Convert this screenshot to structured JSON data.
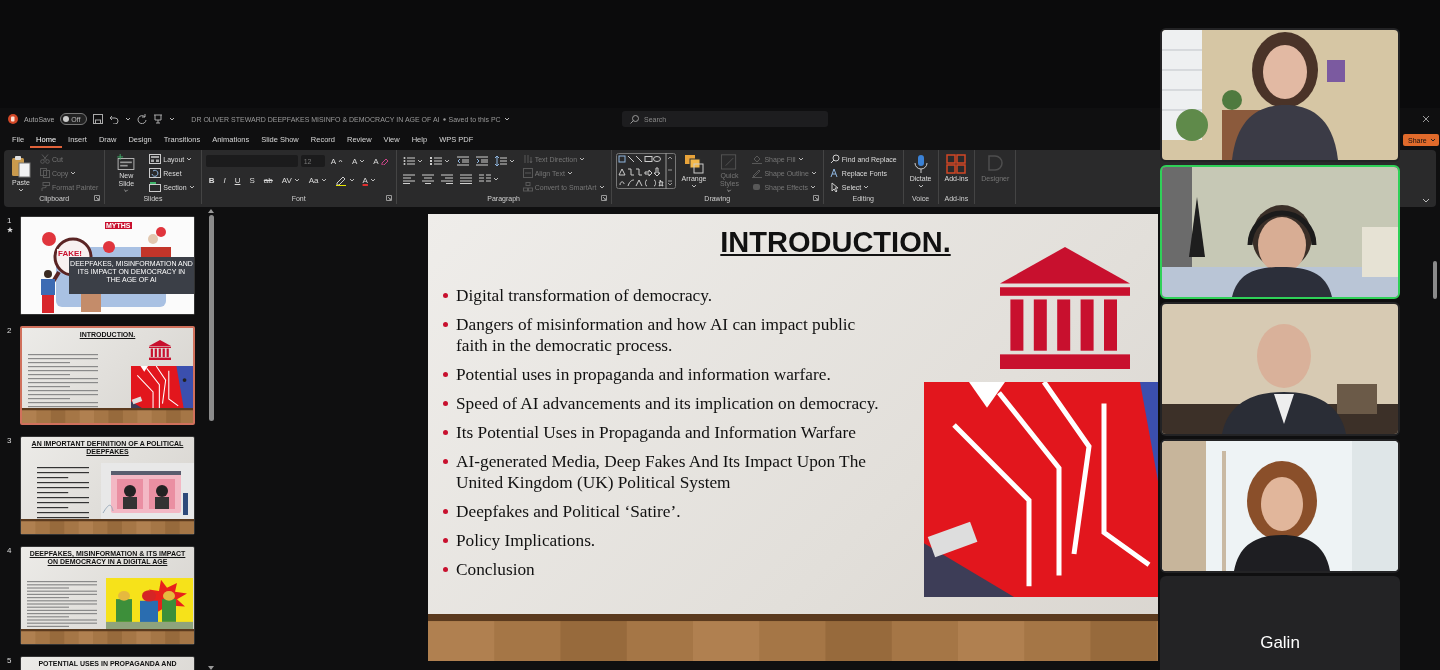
{
  "window": {
    "title": "DR OLIVER STEWARD DEEPFAKES MISINFO & DEMOCRACY IN AGE OF AI",
    "save_status": "Saved to this PC"
  },
  "autosave": {
    "label": "AutoSave",
    "state_label": "Off",
    "on": false
  },
  "search": {
    "placeholder": "Search"
  },
  "share_button": {
    "label": "Share"
  },
  "ribbon_tabs": [
    {
      "label": "File",
      "selected": false
    },
    {
      "label": "Home",
      "selected": true
    },
    {
      "label": "Insert",
      "selected": false
    },
    {
      "label": "Draw",
      "selected": false
    },
    {
      "label": "Design",
      "selected": false
    },
    {
      "label": "Transitions",
      "selected": false
    },
    {
      "label": "Animations",
      "selected": false
    },
    {
      "label": "Slide Show",
      "selected": false
    },
    {
      "label": "Record",
      "selected": false
    },
    {
      "label": "Review",
      "selected": false
    },
    {
      "label": "View",
      "selected": false
    },
    {
      "label": "Help",
      "selected": false
    },
    {
      "label": "WPS PDF",
      "selected": false
    }
  ],
  "ribbon_groups": [
    {
      "label": "Clipboard",
      "launcher": true,
      "columns": [
        [
          {
            "kind": "paste",
            "label": "Paste",
            "large": true,
            "dropdown": true,
            "disabled": false
          }
        ],
        [
          {
            "kind": "cut",
            "label": "Cut",
            "disabled": true
          },
          {
            "kind": "copy",
            "label": "Copy",
            "dropdown": true,
            "disabled": true
          },
          {
            "kind": "painter",
            "label": "Format Painter",
            "disabled": true
          }
        ]
      ]
    },
    {
      "label": "Slides",
      "columns": [
        [
          {
            "kind": "newslide",
            "label": "New Slide",
            "large": true,
            "dropdown": true
          }
        ],
        [
          {
            "kind": "layout",
            "label": "Layout",
            "dropdown": true
          },
          {
            "kind": "reset",
            "label": "Reset"
          },
          {
            "kind": "section",
            "label": "Section",
            "dropdown": true
          }
        ]
      ]
    },
    {
      "label": "Font",
      "launcher": true,
      "rows": [
        [
          {
            "kind": "fontname"
          },
          {
            "kind": "fontsize",
            "value": "12",
            "disabled": true
          },
          {
            "kind": "grow",
            "label": "A"
          },
          {
            "kind": "shrink",
            "label": "A"
          },
          {
            "kind": "clear",
            "label": "A"
          }
        ],
        [
          {
            "kind": "bold",
            "label": "B"
          },
          {
            "kind": "italic",
            "label": "I"
          },
          {
            "kind": "underline",
            "label": "U"
          },
          {
            "kind": "shadow",
            "label": "S"
          },
          {
            "kind": "strike",
            "label": "ab"
          },
          {
            "kind": "spacing",
            "label": "AV",
            "dropdown": true
          },
          {
            "kind": "case",
            "label": "Aa",
            "dropdown": true
          },
          {
            "kind": "highlight",
            "dropdown": true
          },
          {
            "kind": "color",
            "label": "A",
            "dropdown": true
          }
        ]
      ]
    },
    {
      "label": "Paragraph",
      "launcher": true,
      "rows": [
        [
          {
            "kind": "bullets",
            "dropdown": true
          },
          {
            "kind": "numbering",
            "dropdown": true
          },
          {
            "kind": "outdent"
          },
          {
            "kind": "indent"
          },
          {
            "kind": "linespacing",
            "dropdown": true
          }
        ],
        [
          {
            "kind": "alignleft"
          },
          {
            "kind": "aligncenter"
          },
          {
            "kind": "alignright"
          },
          {
            "kind": "justify"
          },
          {
            "kind": "columns",
            "dropdown": true
          }
        ]
      ],
      "columns": [
        [
          {
            "kind": "textdir",
            "label": "Text Direction",
            "dropdown": true,
            "disabled": true
          },
          {
            "kind": "aligntext",
            "label": "Align Text",
            "dropdown": true,
            "disabled": true
          },
          {
            "kind": "smartart",
            "label": "Convert to SmartArt",
            "dropdown": true,
            "disabled": true
          }
        ]
      ]
    },
    {
      "label": "Drawing",
      "launcher": true,
      "columns": [
        [
          {
            "kind": "shapes"
          }
        ],
        [
          {
            "kind": "arrange",
            "label": "Arrange",
            "large": true,
            "dropdown": true
          }
        ],
        [
          {
            "kind": "quickstyles",
            "label": "Quick Styles",
            "large": true,
            "dropdown": true,
            "disabled": true
          }
        ],
        [
          {
            "kind": "shapefill",
            "label": "Shape Fill",
            "dropdown": true,
            "disabled": true
          },
          {
            "kind": "shapeoutline",
            "label": "Shape Outline",
            "dropdown": true,
            "disabled": true
          },
          {
            "kind": "shapeeffects",
            "label": "Shape Effects",
            "dropdown": true,
            "disabled": true
          }
        ]
      ]
    },
    {
      "label": "Editing",
      "columns": [
        [
          {
            "kind": "find",
            "label": "Find and Replace"
          },
          {
            "kind": "fonts",
            "label": "Replace Fonts"
          },
          {
            "kind": "select",
            "label": "Select",
            "dropdown": true
          }
        ]
      ]
    },
    {
      "label": "Voice",
      "columns": [
        [
          {
            "kind": "dictate",
            "label": "Dictate",
            "large": true,
            "dropdown": true
          }
        ]
      ]
    },
    {
      "label": "Add-ins",
      "columns": [
        [
          {
            "kind": "addins",
            "label": "Add-ins",
            "large": true
          }
        ]
      ]
    },
    {
      "columns": [
        [
          {
            "kind": "designer",
            "label": "Designer",
            "large": true,
            "disabled": true
          }
        ]
      ]
    }
  ],
  "slides": [
    {
      "number": "1",
      "selected": false,
      "animated": true,
      "kind": "cover",
      "title": "DEEPFAKES, MISINFORMATION AND ITS IMPACT ON DEMOCRACY IN THE AGE OF AI",
      "labels": [
        "FAKE!",
        "MYTHS"
      ]
    },
    {
      "number": "2",
      "selected": true,
      "animated": false,
      "kind": "bullets",
      "title": "INTRODUCTION."
    },
    {
      "number": "3",
      "selected": false,
      "animated": false,
      "kind": "quote",
      "title": "AN IMPORTANT DEFINITION OF A POLITICAL DEEPFAKES"
    },
    {
      "number": "4",
      "selected": false,
      "animated": false,
      "kind": "popart",
      "title": "DEEPFAKES, MISINFORMATION & ITS IMPACT ON DEMOCRACY IN A DIGITAL AGE"
    },
    {
      "number": "5",
      "selected": false,
      "animated": false,
      "kind": "cut",
      "title": "POTENTIAL USES IN PROPAGANDA AND"
    }
  ],
  "slide": {
    "title": "INTRODUCTION.",
    "bullets": [
      "Digital transformation of democracy.",
      "Dangers of misinformation and how AI can impact public faith in the democratic process.",
      "Potential uses in propaganda and information warfare.",
      "Speed of AI advancements and its implication on democracy.",
      "Its Potential Uses in Propaganda and Information Warfare",
      "AI-generated Media, Deep Fakes And Its Impact Upon The United Kingdom (UK) Political System",
      "Deepfakes and Political ‘Satire’.",
      "Policy Implications.",
      "Conclusion"
    ]
  },
  "participants": [
    {
      "kind": "video",
      "speaking": false
    },
    {
      "kind": "video",
      "speaking": true
    },
    {
      "kind": "video",
      "speaking": false
    },
    {
      "kind": "video",
      "speaking": false
    },
    {
      "kind": "name",
      "name": "Galin",
      "speaking": false
    }
  ]
}
